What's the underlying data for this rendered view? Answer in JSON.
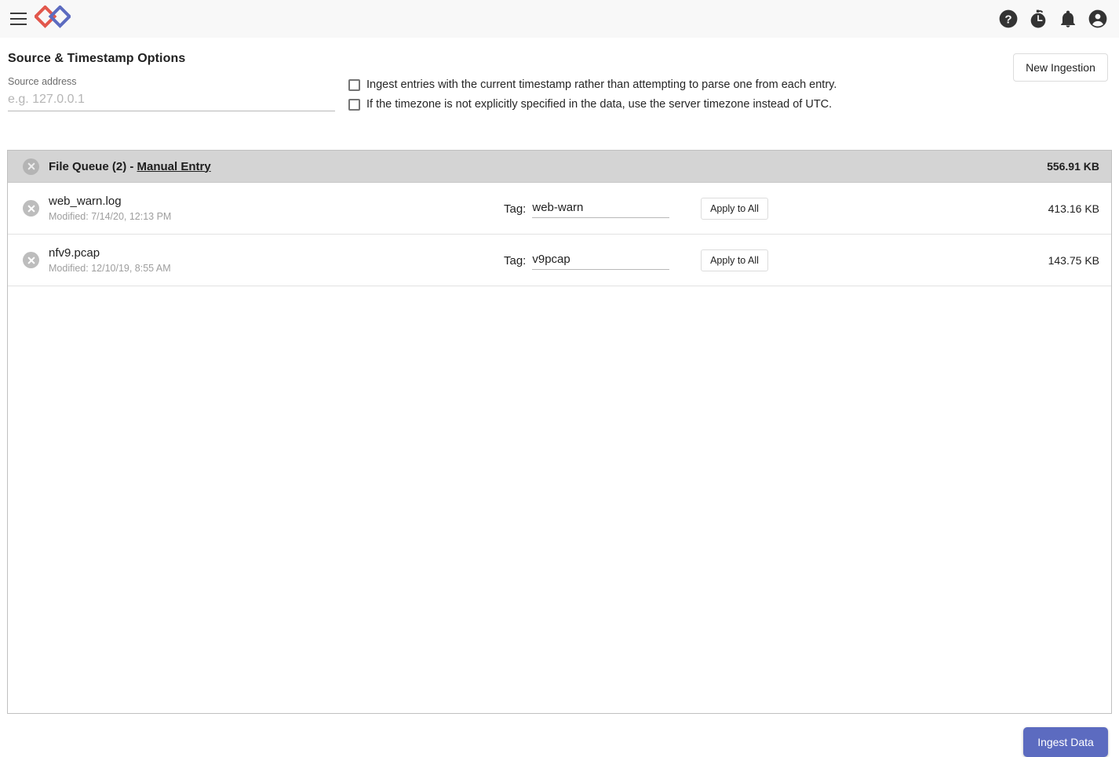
{
  "appbar": {
    "menu_icon": "hamburger-menu-icon",
    "logo": "app-logo-diamonds",
    "logo_colors": {
      "red": "#e2574c",
      "blue": "#5c6bc0"
    },
    "icons": [
      {
        "name": "help-icon",
        "title": "Help"
      },
      {
        "name": "timelapse-icon",
        "title": "Timelapse"
      },
      {
        "name": "notifications-bell-icon",
        "title": "Notifications"
      },
      {
        "name": "account-circle-icon",
        "title": "Account"
      }
    ]
  },
  "section": {
    "title": "Source & Timestamp Options",
    "new_ingestion_label": "New Ingestion"
  },
  "source": {
    "label": "Source address",
    "placeholder": "e.g. 127.0.0.1",
    "value": ""
  },
  "options": [
    {
      "label": "Ingest entries with the current timestamp rather than attempting to parse one from each entry.",
      "checked": false
    },
    {
      "label": "If the timezone is not explicitly specified in the data, use the server timezone instead of UTC.",
      "checked": false
    }
  ],
  "queue": {
    "title_prefix": "File Queue (2) - ",
    "title_link": "Manual Entry",
    "total_size": "556.91 KB",
    "tag_label": "Tag:",
    "apply_label": "Apply to All",
    "rows": [
      {
        "filename": "web_warn.log",
        "modified": "Modified: 7/14/20, 12:13 PM",
        "tag": "web-warn",
        "size": "413.16 KB"
      },
      {
        "filename": "nfv9.pcap",
        "modified": "Modified: 12/10/19, 8:55 AM",
        "tag": "v9pcap",
        "size": "143.75 KB"
      }
    ]
  },
  "footer": {
    "ingest_label": "Ingest Data",
    "ingest_color": "#5c6bc0"
  }
}
